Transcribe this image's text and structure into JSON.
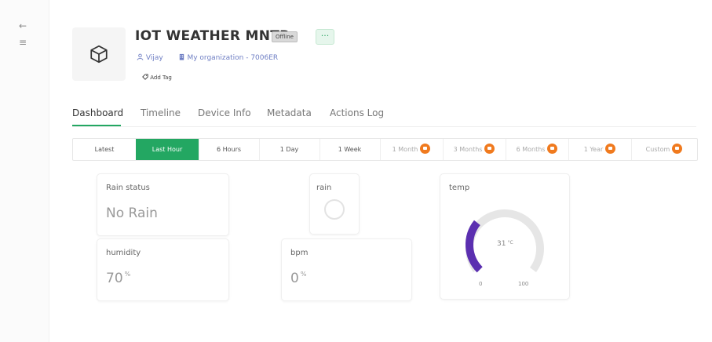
{
  "rail": {
    "back_icon": "←",
    "menu_icon": "≡"
  },
  "header": {
    "title": "IOT WEATHER MNTR",
    "status_badge": "Offline",
    "more_label": "···",
    "owner": "Vijay",
    "organization": "My organization - 7006ER",
    "add_tag": "Add Tag"
  },
  "tabs": [
    {
      "label": "Dashboard",
      "active": true
    },
    {
      "label": "Timeline"
    },
    {
      "label": "Device Info"
    },
    {
      "label": "Metadata"
    },
    {
      "label": "Actions Log"
    }
  ],
  "timerange": [
    {
      "label": "Latest"
    },
    {
      "label": "Last Hour",
      "active": true
    },
    {
      "label": "6 Hours"
    },
    {
      "label": "1 Day"
    },
    {
      "label": "1 Week"
    },
    {
      "label": "1 Month",
      "locked": true
    },
    {
      "label": "3 Months",
      "locked": true
    },
    {
      "label": "6 Months",
      "locked": true
    },
    {
      "label": "1 Year",
      "locked": true
    },
    {
      "label": "Custom",
      "locked": true
    }
  ],
  "widgets": {
    "rain_status": {
      "label": "Rain status",
      "value": "No Rain"
    },
    "rain": {
      "label": "rain"
    },
    "temp": {
      "label": "temp",
      "value": "31",
      "unit": "°C",
      "min": "0",
      "max": "100",
      "level": 0.31
    },
    "humidity": {
      "label": "humidity",
      "value": "70",
      "unit": "%"
    },
    "bpm": {
      "label": "bpm",
      "value": "0",
      "unit": "%"
    }
  },
  "colors": {
    "accent": "#23a762",
    "gauge_fill": "#5b2fb0",
    "gauge_track": "#e6e6e6",
    "lock": "#f07a1e",
    "link": "#6f7fc4"
  }
}
